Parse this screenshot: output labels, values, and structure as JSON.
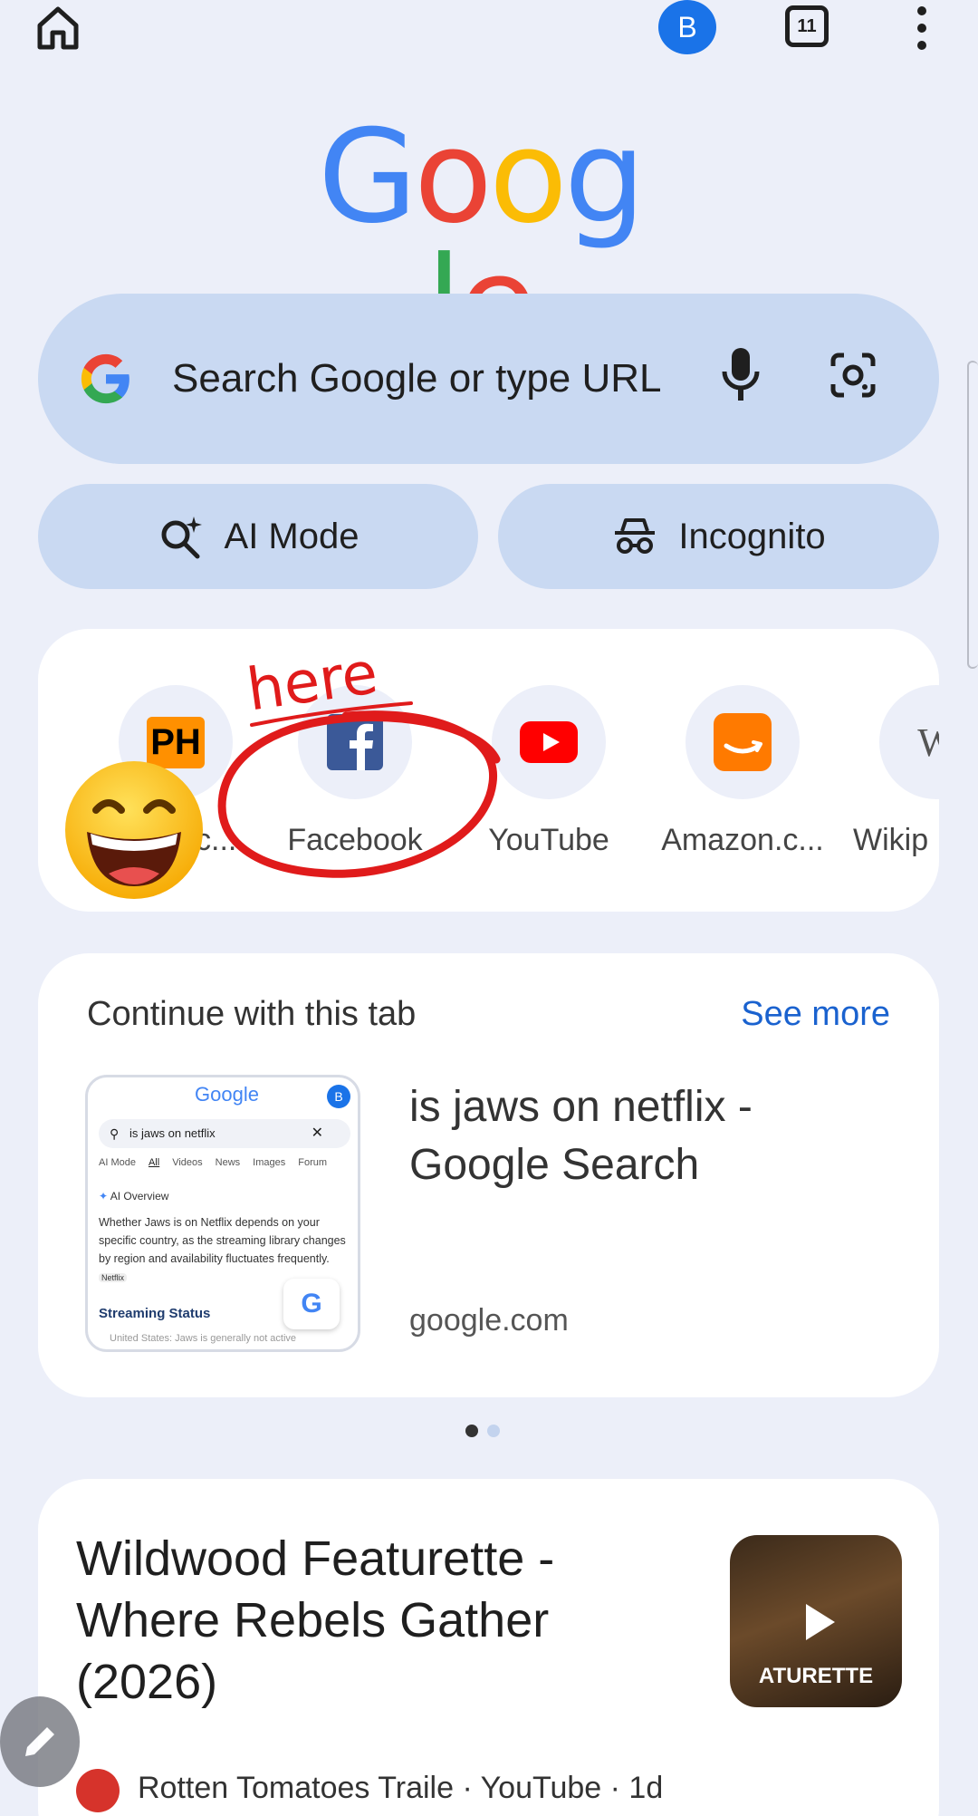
{
  "topbar": {
    "avatar_letter": "B",
    "tab_count": "11"
  },
  "logo": {
    "letters": [
      "G",
      "o",
      "o",
      "g",
      "l",
      "e"
    ],
    "colors": [
      "#4285f4",
      "#ea4335",
      "#fbbc05",
      "#4285f4",
      "#34a853",
      "#ea4335"
    ]
  },
  "search": {
    "placeholder": "Search Google or type URL"
  },
  "pills": {
    "ai_mode": "AI Mode",
    "incognito": "Incognito"
  },
  "shortcuts": [
    {
      "label": ".c...",
      "icon": "ph-icon",
      "badge": "PH"
    },
    {
      "label": "Facebook",
      "icon": "facebook-icon"
    },
    {
      "label": "YouTube",
      "icon": "youtube-icon"
    },
    {
      "label": "Amazon.c...",
      "icon": "amazon-icon"
    },
    {
      "label": "Wikip",
      "icon": "wikipedia-icon",
      "badge": "W"
    }
  ],
  "annotation": {
    "text": "here"
  },
  "continue_tab": {
    "heading": "Continue with this tab",
    "see_more": "See more",
    "title": "is jaws on netflix - Google Search",
    "domain": "google.com",
    "thumbnail": {
      "logo": "Google",
      "avatar": "B",
      "query": "is jaws on netflix",
      "tabs": [
        "AI Mode",
        "All",
        "Videos",
        "News",
        "Images",
        "Forum"
      ],
      "ai_overview": "AI Overview",
      "body": "Whether Jaws is on Netflix depends on your specific country, as the streaming library changes by region and availability fluctuates frequently.",
      "body_tag": "Netflix",
      "section": "Streaming Status",
      "cut_line": "United States: Jaws is generally not active"
    }
  },
  "pager": {
    "dots": 2,
    "active": 0
  },
  "feed": {
    "title": "Wildwood Featurette - Where Rebels Gather (2026)",
    "thumb_text": "ATURETTE",
    "source": "Rotten Tomatoes Traile",
    "meta": "· YouTube · 1d"
  },
  "colors": {
    "accent": "#1a73e8",
    "surface": "#c9d9f2",
    "background": "#eceff9",
    "annotation": "#e01b1b"
  }
}
